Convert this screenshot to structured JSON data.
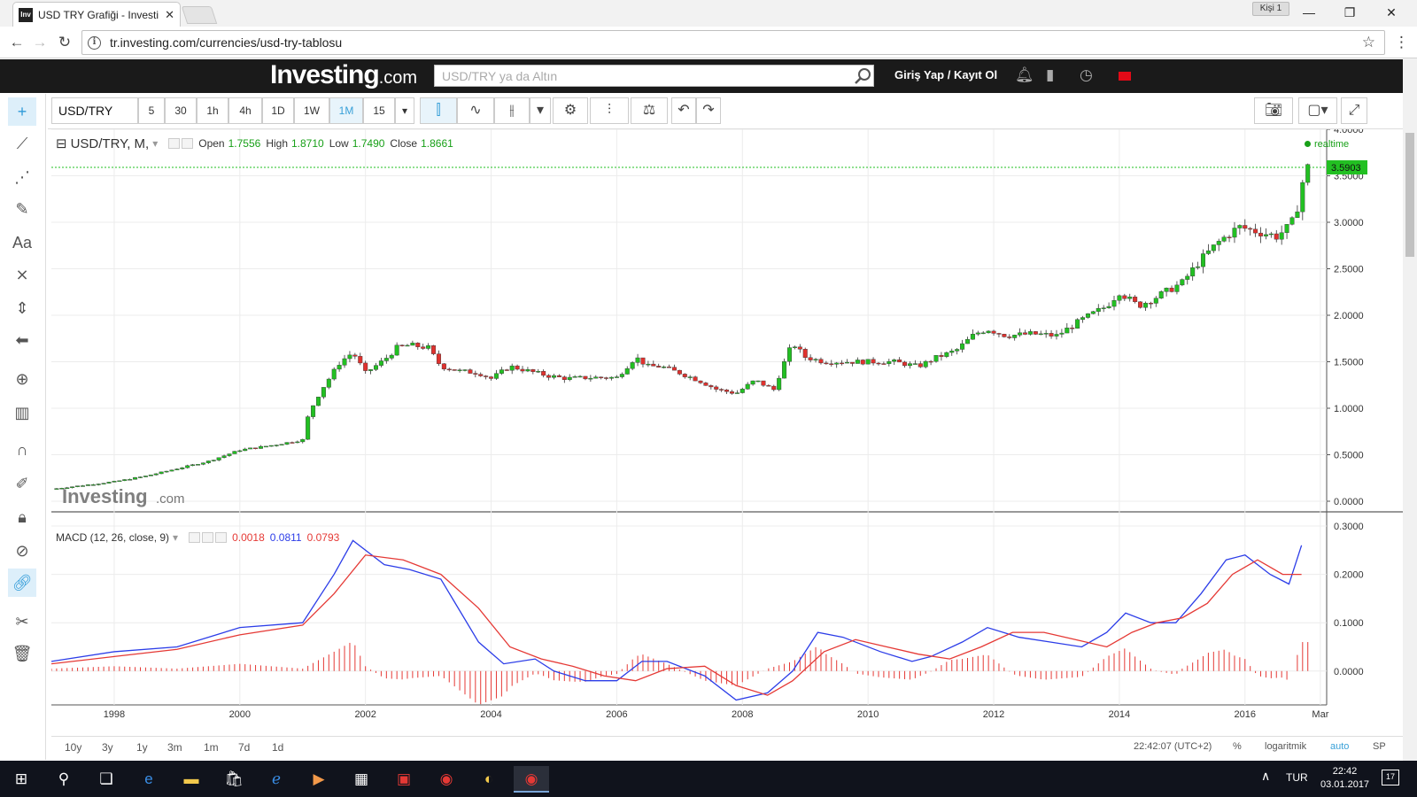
{
  "browser": {
    "tab_title": "USD TRY Grafiği - Investi",
    "tab_favicon": "Inv",
    "profile": "Kişi 1",
    "url": "tr.investing.com/currencies/usd-try-tablosu"
  },
  "site": {
    "logo_main": "Investing",
    "logo_suffix": ".com",
    "search_placeholder": "USD/TRY ya da Altın",
    "login_label": "Giriş Yap / Kayıt Ol"
  },
  "toolbar": {
    "symbol": "USD/TRY",
    "timeframes": [
      "5",
      "30",
      "1h",
      "4h",
      "1D",
      "1W",
      "1M",
      "15"
    ],
    "active_timeframe": "1M"
  },
  "legend": {
    "symbol": "USD/TRY, M,",
    "open_label": "Open",
    "open": "1.7556",
    "high_label": "High",
    "high": "1.8710",
    "low_label": "Low",
    "low": "1.7490",
    "close_label": "Close",
    "close": "1.8661",
    "realtime": "realtime"
  },
  "macd_legend": {
    "label": "MACD (12, 26, close, 9)",
    "hist": "0.0018",
    "macd": "0.0811",
    "signal": "0.0793"
  },
  "watermark": {
    "main": "Investing",
    "suffix": ".com"
  },
  "last_price_label": "3.5903",
  "colors": {
    "up": "#22c022",
    "down": "#e0312e",
    "macd": "#2c3de8",
    "signal": "#e53935",
    "accent": "#38a0d8"
  },
  "bottom_bar": {
    "ranges": [
      "10y",
      "3y",
      "1y",
      "3m",
      "1m",
      "7d",
      "1d"
    ],
    "time": "22:42:07 (UTC+2)",
    "percent": "%",
    "log": "logaritmik",
    "auto": "auto",
    "sp": "SP"
  },
  "taskbar": {
    "lang": "TUR",
    "time": "22:42",
    "date": "03.01.2017",
    "notifications": "17"
  },
  "chart_data": [
    {
      "type": "line",
      "title": "USD/TRY, M,",
      "xlabel": "",
      "ylabel": "",
      "x_ticks": [
        "1998",
        "2000",
        "2002",
        "2004",
        "2006",
        "2008",
        "2010",
        "2012",
        "2014",
        "2016",
        "Mar"
      ],
      "y_ticks": [
        "0.0000",
        "0.5000",
        "1.0000",
        "1.5000",
        "2.0000",
        "2.5000",
        "3.0000",
        "3.5000",
        "4.0000"
      ],
      "ylim": [
        0,
        4
      ],
      "xlim": [
        1997.0,
        2017.3
      ],
      "series": [
        {
          "name": "",
          "x": [
            1997.0,
            1997.5,
            1998.0,
            1998.5,
            1999.0,
            1999.5,
            2000.0,
            2000.5,
            2001.0,
            2001.1,
            2001.3,
            2001.6,
            2001.8,
            2002.0,
            2002.3,
            2002.5,
            2002.7,
            2003.0,
            2003.2,
            2003.5,
            2003.8,
            2004.0,
            2004.3,
            2004.6,
            2004.9,
            2005.2,
            2005.6,
            2006.0,
            2006.3,
            2006.5,
            2006.7,
            2007.0,
            2007.3,
            2007.6,
            2007.9,
            2008.2,
            2008.5,
            2008.7,
            2008.8,
            2009.0,
            2009.3,
            2009.7,
            2010.0,
            2010.4,
            2010.8,
            2011.1,
            2011.4,
            2011.7,
            2011.9,
            2012.2,
            2012.6,
            2013.0,
            2013.4,
            2013.8,
            2014.0,
            2014.3,
            2014.6,
            2015.0,
            2015.3,
            2015.6,
            2015.9,
            2016.2,
            2016.5,
            2016.7,
            2016.8,
            2016.9,
            2017.0
          ],
          "y": [
            0.13,
            0.17,
            0.21,
            0.27,
            0.35,
            0.43,
            0.55,
            0.6,
            0.66,
            0.95,
            1.2,
            1.5,
            1.6,
            1.38,
            1.52,
            1.65,
            1.68,
            1.65,
            1.45,
            1.4,
            1.38,
            1.32,
            1.45,
            1.4,
            1.35,
            1.32,
            1.33,
            1.33,
            1.55,
            1.45,
            1.45,
            1.38,
            1.3,
            1.2,
            1.16,
            1.3,
            1.2,
            1.55,
            1.7,
            1.55,
            1.5,
            1.5,
            1.5,
            1.5,
            1.45,
            1.55,
            1.62,
            1.8,
            1.85,
            1.78,
            1.8,
            1.78,
            1.95,
            2.1,
            2.25,
            2.1,
            2.2,
            2.35,
            2.6,
            2.8,
            2.95,
            2.9,
            2.85,
            2.95,
            3.05,
            3.4,
            3.59
          ]
        }
      ]
    },
    {
      "type": "line",
      "title": "MACD (12, 26, close, 9)",
      "y_ticks": [
        "0.0000",
        "0.1000",
        "0.2000",
        "0.3000"
      ],
      "ylim": [
        -0.07,
        0.3
      ],
      "series": [
        {
          "name": "",
          "x": [
            1997.0,
            1998.0,
            1999.0,
            2000.0,
            2001.0,
            2001.5,
            2001.8,
            2002.3,
            2002.7,
            2003.2,
            2003.8,
            2004.2,
            2004.7,
            2005.0,
            2005.5,
            2006.0,
            2006.4,
            2006.8,
            2007.4,
            2007.9,
            2008.4,
            2008.8,
            2009.2,
            2009.6,
            2010.2,
            2010.7,
            2011.0,
            2011.5,
            2011.9,
            2012.4,
            2012.9,
            2013.4,
            2013.8,
            2014.1,
            2014.5,
            2014.9,
            2015.3,
            2015.7,
            2016.0,
            2016.4,
            2016.7,
            2016.9
          ],
          "y": [
            0.02,
            0.04,
            0.05,
            0.09,
            0.1,
            0.2,
            0.27,
            0.22,
            0.21,
            0.19,
            0.06,
            0.015,
            0.025,
            0.0,
            -0.02,
            -0.02,
            0.02,
            0.02,
            -0.01,
            -0.06,
            -0.045,
            0.0,
            0.08,
            0.07,
            0.04,
            0.02,
            0.03,
            0.06,
            0.09,
            0.07,
            0.06,
            0.05,
            0.08,
            0.12,
            0.1,
            0.1,
            0.16,
            0.23,
            0.24,
            0.2,
            0.18,
            0.26
          ]
        },
        {
          "name": "",
          "x": [
            1997.0,
            1998.0,
            1999.0,
            2000.0,
            2001.0,
            2001.5,
            2002.0,
            2002.6,
            2003.2,
            2003.8,
            2004.3,
            2004.8,
            2005.3,
            2005.8,
            2006.3,
            2006.8,
            2007.4,
            2007.9,
            2008.4,
            2008.8,
            2009.3,
            2009.8,
            2010.3,
            2010.8,
            2011.3,
            2011.8,
            2012.3,
            2012.8,
            2013.3,
            2013.8,
            2014.2,
            2014.6,
            2015.0,
            2015.4,
            2015.8,
            2016.2,
            2016.6,
            2016.9
          ],
          "y": [
            0.015,
            0.03,
            0.045,
            0.075,
            0.095,
            0.16,
            0.24,
            0.23,
            0.2,
            0.13,
            0.05,
            0.025,
            0.01,
            -0.01,
            -0.02,
            0.005,
            0.01,
            -0.03,
            -0.05,
            -0.02,
            0.04,
            0.065,
            0.05,
            0.035,
            0.025,
            0.05,
            0.08,
            0.08,
            0.065,
            0.05,
            0.08,
            0.1,
            0.11,
            0.14,
            0.2,
            0.23,
            0.2,
            0.2
          ]
        }
      ]
    }
  ]
}
